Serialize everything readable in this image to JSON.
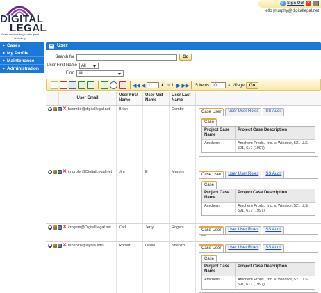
{
  "brand": {
    "line1": "DIGITAL",
    "line2": "LEGAL",
    "tagline": "Great verdicts begin with great discovery."
  },
  "header": {
    "signout_label": "Sign Out",
    "greeting": "Hello jmurphy@digitallegal.net"
  },
  "sidebar": {
    "items": [
      {
        "label": "Cases"
      },
      {
        "label": "My Profile"
      },
      {
        "label": "Maintenance"
      },
      {
        "label": "Administration"
      }
    ]
  },
  "main": {
    "title": "User"
  },
  "filters": {
    "search_label": "Search for",
    "search_value": "",
    "go_label": "Go",
    "user_first_name_label": "User First Name",
    "user_first_name_value": "All",
    "firm_label": "Firm",
    "firm_value": "All"
  },
  "pager": {
    "page_value": "1",
    "of_text": "of 1",
    "items_text": "5 Items",
    "per_page_value": "10",
    "per_page_label": "/Page",
    "go_label": "Go"
  },
  "table": {
    "columns": [
      "User Email",
      "User First Name",
      "User Mid Name",
      "User Last Name"
    ],
    "rows": [
      {
        "email": "bcombe@digitallegal.net",
        "first": "Brian",
        "mid": "",
        "last": "Combe",
        "tabs": [
          "Case User",
          "User User Roles",
          "SS Audit"
        ],
        "expanded": true,
        "subtab": "Case",
        "case_cols": [
          "Project Case Name",
          "Project Case Description"
        ],
        "case_name": "Amchem",
        "case_desc": "Amchem Prods., Inc. v. Windsor, 521 U.S. 591, 617 (1997)"
      },
      {
        "email": "jmurphy@DigitalLegal.net",
        "first": "Jim",
        "mid": "E",
        "last": "Murphy",
        "tabs": [
          "Case User",
          "User User Roles",
          "SS Audit"
        ],
        "expanded": true,
        "subtab": "Case",
        "case_cols": [
          "Project Case Name",
          "Project Case Description"
        ],
        "case_name": "Amchem",
        "case_desc": "Amchem Prods., Inc. v. Windsor, 521 U.S. 591, 617 (1997)"
      },
      {
        "email": "crogers@DigitalLegal.net",
        "first": "Carl",
        "mid": "Jerry",
        "last": "Rogers",
        "tabs": [
          "Case User",
          "User User Roles",
          "SS Audit"
        ],
        "expanded": false
      },
      {
        "email": "rshapiro@loyola.edu",
        "first": "Robert",
        "mid": "Leslie",
        "last": "Shapiro",
        "tabs": [
          "Case User",
          "User User Roles",
          "SS Audit"
        ],
        "expanded": true,
        "subtab": "Case",
        "case_cols": [
          "Project Case Name",
          "Project Case Description"
        ],
        "case_name": "Amchem",
        "case_desc": "Amchem Prods., Inc. v. Windsor, 521 U.S. 591, 617 (1997)"
      }
    ]
  }
}
